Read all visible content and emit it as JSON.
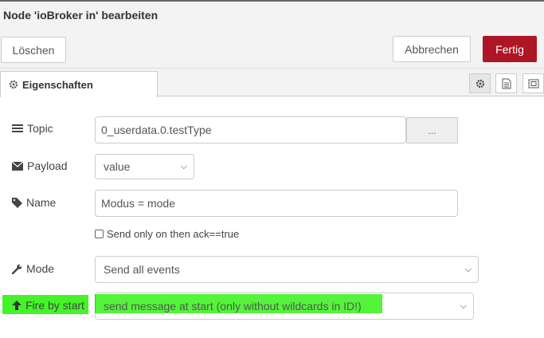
{
  "window": {
    "title": "Node 'ioBroker in' bearbeiten"
  },
  "toolbar": {
    "delete_label": "Löschen",
    "cancel_label": "Abbrechen",
    "done_label": "Fertig"
  },
  "tabs": {
    "properties_label": "Eigenschaften"
  },
  "form": {
    "topic": {
      "label": "Topic",
      "value": "0_userdata.0.testType",
      "browse_label": "..."
    },
    "payload": {
      "label": "Payload",
      "value": "value"
    },
    "name": {
      "label": "Name",
      "value": "Modus = mode"
    },
    "ack_checkbox": {
      "label": "Send only on then ack==true",
      "checked": false
    },
    "mode": {
      "label": "Mode",
      "value": "Send all events"
    },
    "fire_by_start": {
      "label": "Fire by start",
      "value": "send message at start (only without wildcards in ID!)"
    }
  },
  "colors": {
    "done_button": "#ad1625",
    "highlight": "#35f217"
  }
}
